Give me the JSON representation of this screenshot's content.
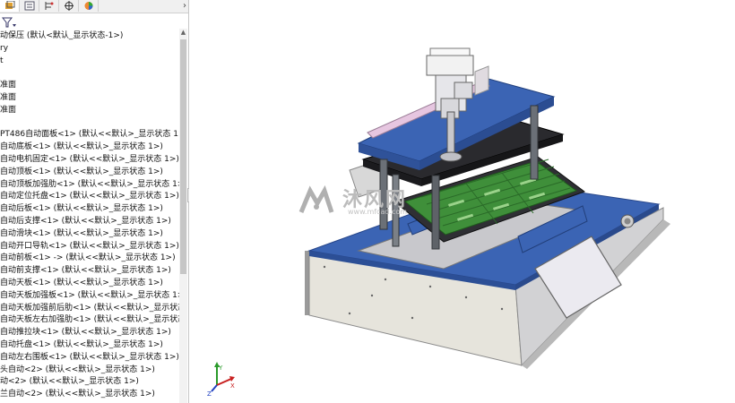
{
  "panel": {
    "tab_expand": "›",
    "tree_rows": [
      "动保压 (默认<默认_显示状态-1>)",
      "ry",
      "t",
      "",
      "准面",
      "准面",
      "准面",
      "",
      "PT486自动面板<1> (默认<<默认>_显示状态 1>)",
      "自动底板<1> (默认<<默认>_显示状态 1>)",
      "自动电机固定<1> (默认<<默认>_显示状态 1>)",
      "自动顶板<1> (默认<<默认>_显示状态 1>)",
      "自动顶板加强肋<1> (默认<<默认>_显示状态 1>)",
      "自动定位托盘<1> (默认<<默认>_显示状态 1>)",
      "自动后板<1> (默认<<默认>_显示状态 1>)",
      "自动后支撑<1> (默认<<默认>_显示状态 1>)",
      "自动滑块<1> (默认<<默认>_显示状态 1>)",
      "自动开口导轨<1> (默认<<默认>_显示状态 1>)",
      "自动前板<1> -> (默认<<默认>_显示状态 1>)",
      "自动前支撑<1> (默认<<默认>_显示状态 1>)",
      "自动天板<1> (默认<<默认>_显示状态 1>)",
      "自动天板加强板<1> (默认<<默认>_显示状态 1>)",
      "自动天板加强前后肋<1> (默认<<默认>_显示状态",
      "自动天板左右加强肋<1> (默认<<默认>_显示状态",
      "自动推拉块<1> (默认<<默认>_显示状态 1>)",
      "自动托盘<1> (默认<<默认>_显示状态 1>)",
      "自动左右围板<1> (默认<<默认>_显示状态 1>)",
      "头自动<2> (默认<<默认>_显示状态 1>)",
      "动<2> (默认<<默认>_显示状态 1>)",
      "兰自动<2> (默认<<默认>_显示状态 1>)"
    ]
  },
  "watermark": {
    "text": "沐风网",
    "sub": "www.mfcad.com"
  },
  "colors": {
    "blue_plate": "#3b64b4",
    "grey_body": "#d6d6d6",
    "pcb_green": "#3f8f3a"
  },
  "icons": [
    "feature-tree-icon",
    "property-manager-icon",
    "configuration-manager-icon",
    "dimxpert-icon",
    "display-manager-icon",
    "filter-icon",
    "triad-icon"
  ]
}
